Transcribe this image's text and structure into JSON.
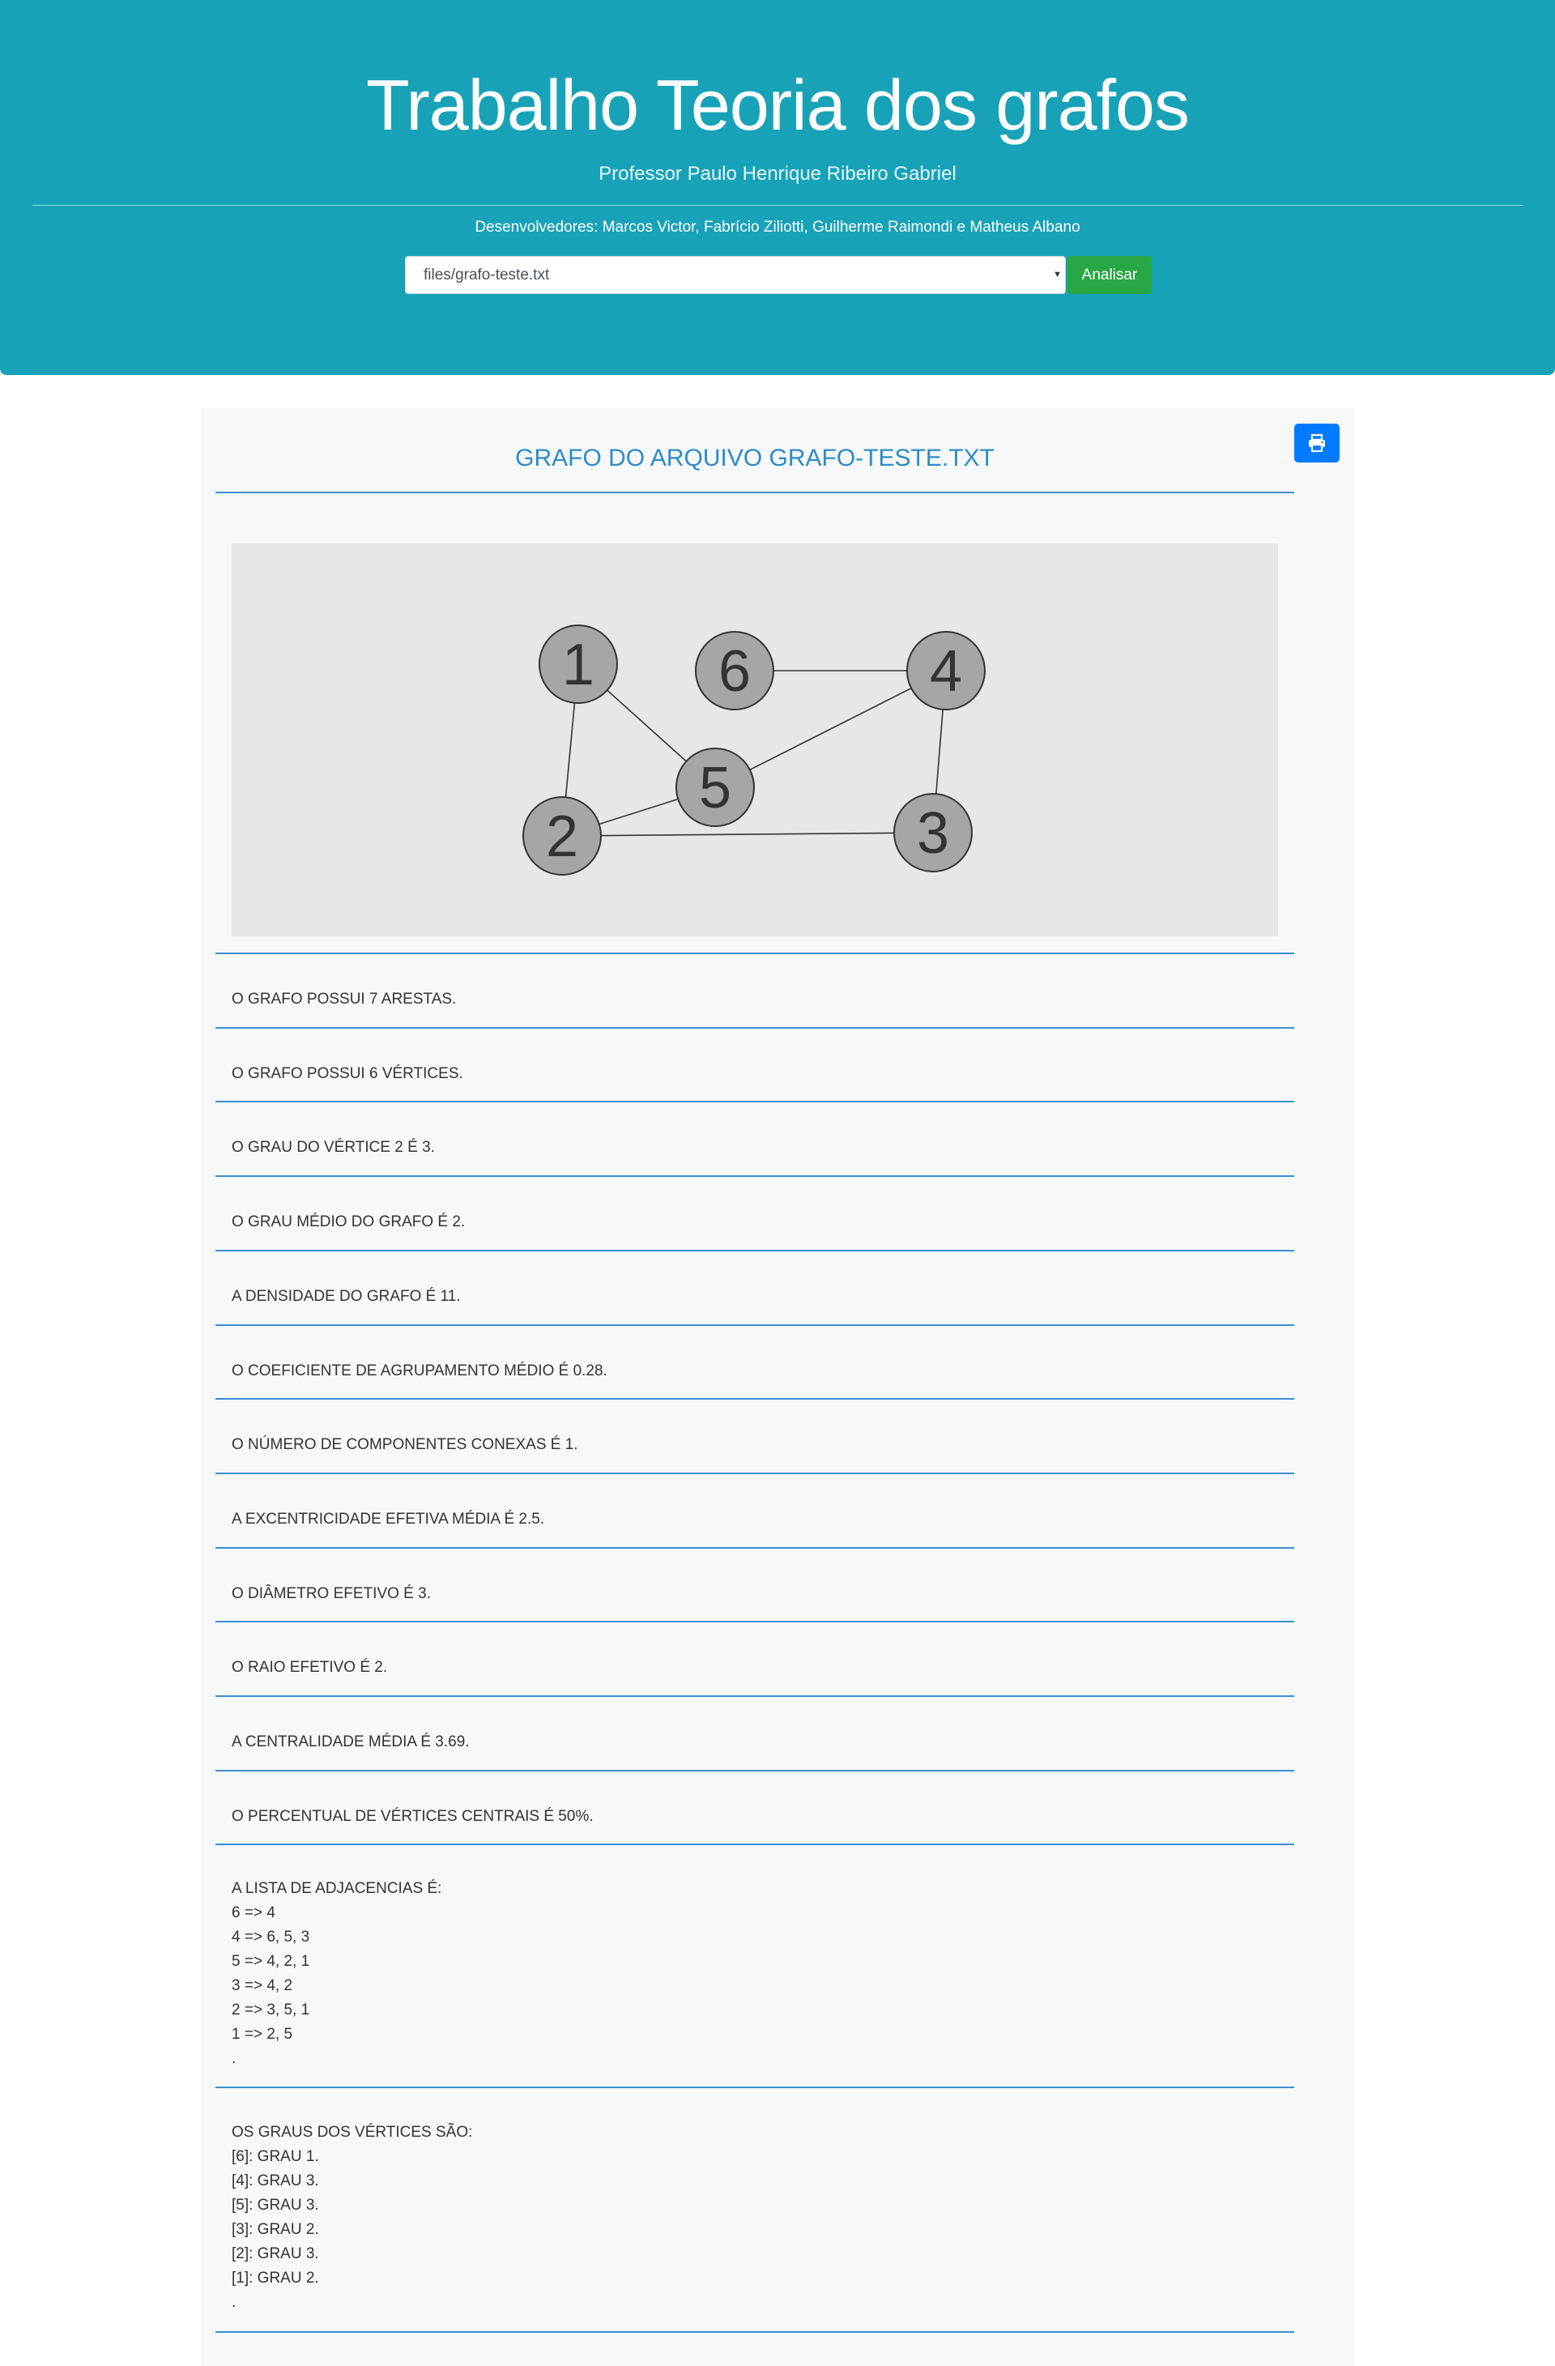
{
  "header": {
    "title": "Trabalho Teoria dos grafos",
    "subtitle": "Professor Paulo Henrique Ribeiro Gabriel",
    "developers": "Desenvolvedores: Marcos Victor, Fabrício Ziliotti, Guilherme Raimondi e Matheus Albano",
    "file_select": {
      "value": "files/grafo-teste.txt"
    },
    "analyze_button": "Analisar"
  },
  "colors": {
    "header_bg": "#17a2b8",
    "accent_blue": "#007bff",
    "analyze_green": "#28a745",
    "title_blue": "#2d8cc7",
    "node_fill": "#a6a6a6",
    "graph_bg": "#e6e7e9"
  },
  "icons": {
    "print": "print-icon"
  },
  "report": {
    "title": "GRAFO DO ARQUIVO GRAFO-TESTE.TXT",
    "graph": {
      "nodes": [
        "1",
        "6",
        "4",
        "5",
        "2",
        "3"
      ],
      "edges": [
        [
          "1",
          "2"
        ],
        [
          "1",
          "5"
        ],
        [
          "6",
          "4"
        ],
        [
          "4",
          "5"
        ],
        [
          "4",
          "3"
        ],
        [
          "5",
          "2"
        ],
        [
          "2",
          "3"
        ]
      ]
    },
    "stats": [
      "O GRAFO POSSUI 7 ARESTAS.",
      "O GRAFO POSSUI 6 VÉRTICES.",
      "O GRAU DO VÉRTICE 2 É 3.",
      "O GRAU MÉDIO DO GRAFO É 2.",
      "A DENSIDADE DO GRAFO É 11.",
      "O COEFICIENTE DE AGRUPAMENTO MÉDIO É 0.28.",
      "O NÚMERO DE COMPONENTES CONEXAS É 1.",
      "A EXCENTRICIDADE EFETIVA MÉDIA É 2.5.",
      "O DIÂMETRO EFETIVO É 3.",
      "O RAIO EFETIVO É 2.",
      "A CENTRALIDADE MÉDIA É 3.69.",
      "O PERCENTUAL DE VÉRTICES CENTRAIS É 50%."
    ],
    "adjacency": {
      "heading": "A LISTA DE ADJACENCIAS É:",
      "lines": [
        "6 => 4",
        "4 => 6, 5, 3",
        "5 => 4, 2, 1",
        "3 => 4, 2",
        "2 => 3, 5, 1",
        "1 => 2, 5"
      ],
      "end": "."
    },
    "degrees": {
      "heading": "OS GRAUS DOS VÉRTICES SÃO:",
      "lines": [
        "[6]: GRAU 1.",
        "[4]: GRAU 3.",
        "[5]: GRAU 3.",
        "[3]: GRAU 2.",
        "[2]: GRAU 3.",
        "[1]: GRAU 2."
      ],
      "end": "."
    }
  }
}
